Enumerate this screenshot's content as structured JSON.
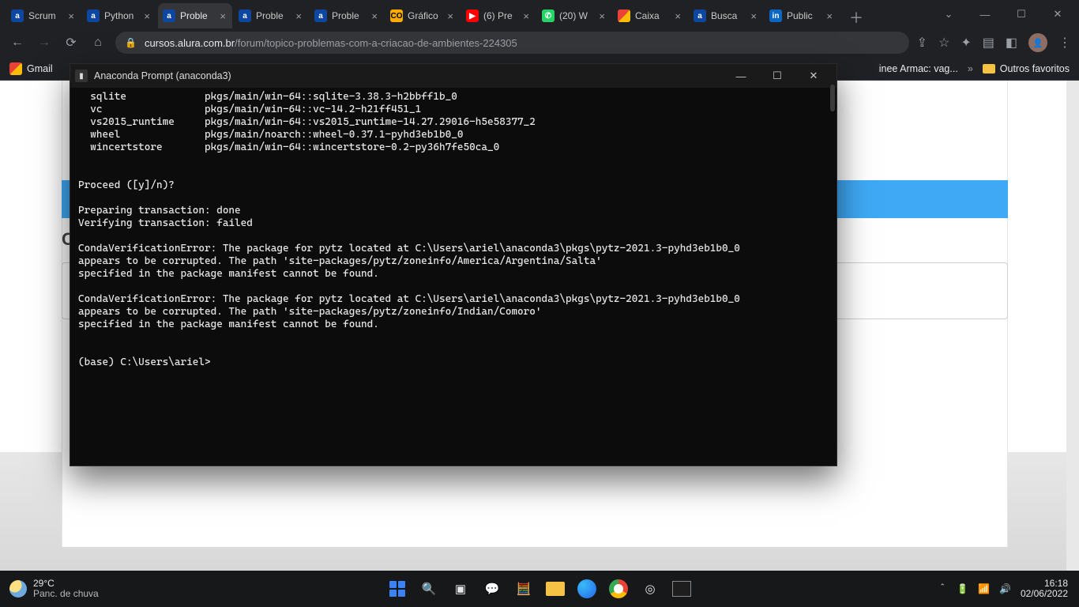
{
  "browser": {
    "tabs": [
      {
        "favicon": "alura",
        "title": "Scrum"
      },
      {
        "favicon": "alura",
        "title": "Python"
      },
      {
        "favicon": "alura",
        "title": "Proble",
        "active": true
      },
      {
        "favicon": "alura",
        "title": "Proble"
      },
      {
        "favicon": "alura",
        "title": "Proble"
      },
      {
        "favicon": "colab",
        "title": "Gráfico"
      },
      {
        "favicon": "yt",
        "title": "(6) Pre"
      },
      {
        "favicon": "wa",
        "title": "(20) W"
      },
      {
        "favicon": "gmail",
        "title": "Caixa"
      },
      {
        "favicon": "alura",
        "title": "Busca"
      },
      {
        "favicon": "li",
        "title": "Public"
      }
    ],
    "url_host": "cursos.alura.com.br",
    "url_path": "/forum/topico-problemas-com-a-criacao-de-ambientes-224305",
    "bookmarks": {
      "gmail": "Gmail",
      "right1": "inee Armac: vag...",
      "right_folder": "Outros favoritos"
    }
  },
  "terminal": {
    "title": "Anaconda Prompt (anaconda3)",
    "lines": "  sqlite             pkgs/main/win-64::sqlite-3.38.3-h2bbff1b_0\n  vc                 pkgs/main/win-64::vc-14.2-h21ff451_1\n  vs2015_runtime     pkgs/main/win-64::vs2015_runtime-14.27.29016-h5e58377_2\n  wheel              pkgs/main/noarch::wheel-0.37.1-pyhd3eb1b0_0\n  wincertstore       pkgs/main/win-64::wincertstore-0.2-py36h7fe50ca_0\n\n\nProceed ([y]/n)?\n\nPreparing transaction: done\nVerifying transaction: failed\n\nCondaVerificationError: The package for pytz located at C:\\Users\\ariel\\anaconda3\\pkgs\\pytz-2021.3-pyhd3eb1b0_0\nappears to be corrupted. The path 'site-packages/pytz/zoneinfo/America/Argentina/Salta'\nspecified in the package manifest cannot be found.\n\nCondaVerificationError: The package for pytz located at C:\\Users\\ariel\\anaconda3\\pkgs\\pytz-2021.3-pyhd3eb1b0_0\nappears to be corrupted. The path 'site-packages/pytz/zoneinfo/Indian/Comoro'\nspecified in the package manifest cannot be found.\n\n\n(base) C:\\Users\\ariel>"
  },
  "taskbar": {
    "temp": "29°C",
    "weather": "Panc. de chuva",
    "time": "16:18",
    "date": "02/06/2022"
  }
}
